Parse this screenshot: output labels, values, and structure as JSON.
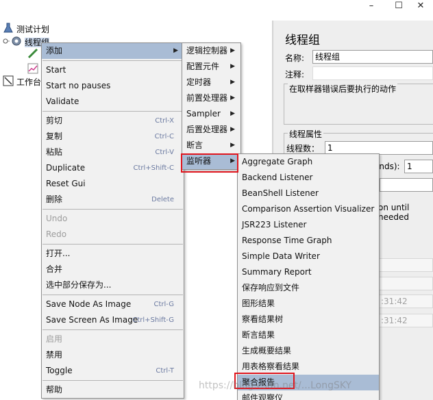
{
  "window": {
    "minimize": "–",
    "maximize": "☐",
    "close": "✕"
  },
  "tree": {
    "test_plan": "测试计划",
    "thread_group": "线程组",
    "workbench": "工作台"
  },
  "right_panel": {
    "title": "线程组",
    "name_label": "名称:",
    "name_value": "线程组",
    "comment_label": "注释:",
    "error_action_label": "在取样器错误后要执行的动作",
    "thread_props_label": "线程属性",
    "threads_label": "线程数：",
    "threads_value": "1",
    "rampup_partial": "onds):",
    "rampup_value": "1",
    "loop_partial": "on until needed",
    "time1": ":31:42",
    "time2": ":31:42"
  },
  "context_menu": {
    "items": [
      {
        "label": "添加",
        "accel": "",
        "submenu": true,
        "enabled": true
      },
      {
        "label": "Start",
        "accel": "",
        "submenu": false,
        "enabled": true
      },
      {
        "label": "Start no pauses",
        "accel": "",
        "submenu": false,
        "enabled": true
      },
      {
        "label": "Validate",
        "accel": "",
        "submenu": false,
        "enabled": true
      },
      {
        "label": "剪切",
        "accel": "Ctrl-X",
        "submenu": false,
        "enabled": true
      },
      {
        "label": "复制",
        "accel": "Ctrl-C",
        "submenu": false,
        "enabled": true
      },
      {
        "label": "粘贴",
        "accel": "Ctrl-V",
        "submenu": false,
        "enabled": true
      },
      {
        "label": "Duplicate",
        "accel": "Ctrl+Shift-C",
        "submenu": false,
        "enabled": true
      },
      {
        "label": "Reset Gui",
        "accel": "",
        "submenu": false,
        "enabled": true
      },
      {
        "label": "删除",
        "accel": "Delete",
        "submenu": false,
        "enabled": true
      },
      {
        "label": "Undo",
        "accel": "",
        "submenu": false,
        "enabled": false
      },
      {
        "label": "Redo",
        "accel": "",
        "submenu": false,
        "enabled": false
      },
      {
        "label": "打开...",
        "accel": "",
        "submenu": false,
        "enabled": true
      },
      {
        "label": "合并",
        "accel": "",
        "submenu": false,
        "enabled": true
      },
      {
        "label": "选中部分保存为...",
        "accel": "",
        "submenu": false,
        "enabled": true
      },
      {
        "label": "Save Node As Image",
        "accel": "Ctrl-G",
        "submenu": false,
        "enabled": true
      },
      {
        "label": "Save Screen As Image",
        "accel": "Ctrl+Shift-G",
        "submenu": false,
        "enabled": true
      },
      {
        "label": "启用",
        "accel": "",
        "submenu": false,
        "enabled": false
      },
      {
        "label": "禁用",
        "accel": "",
        "submenu": false,
        "enabled": true
      },
      {
        "label": "Toggle",
        "accel": "Ctrl-T",
        "submenu": false,
        "enabled": true
      },
      {
        "label": "帮助",
        "accel": "",
        "submenu": false,
        "enabled": true
      }
    ]
  },
  "add_submenu": {
    "items": [
      "逻辑控制器",
      "配置元件",
      "定时器",
      "前置处理器",
      "Sampler",
      "后置处理器",
      "断言",
      "监听器"
    ]
  },
  "listener_submenu": {
    "items": [
      "Aggregate Graph",
      "Backend Listener",
      "BeanShell Listener",
      "Comparison Assertion Visualizer",
      "JSR223 Listener",
      "Response Time Graph",
      "Simple Data Writer",
      "Summary Report",
      "保存响应到文件",
      "图形结果",
      "察看结果树",
      "断言结果",
      "生成概要结果",
      "用表格察看结果",
      "聚合报告",
      "邮件观察仪"
    ]
  },
  "watermark": "https://blog.csdn.net/...LongSKY"
}
